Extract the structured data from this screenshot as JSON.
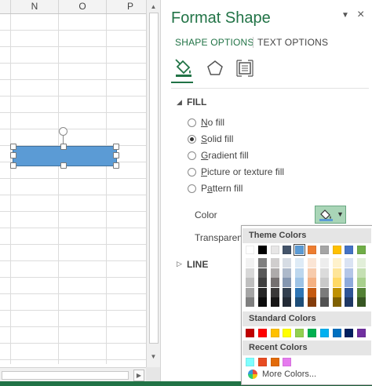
{
  "sheet": {
    "columns": [
      "N",
      "O",
      "P"
    ]
  },
  "pane": {
    "title": "Format Shape",
    "dropdown_icon": "triangle-down-icon",
    "close_label": "×",
    "tabs": [
      "SHAPE OPTIONS",
      "TEXT OPTIONS"
    ],
    "icons": [
      "fill-line-icon",
      "effects-pentagon-icon",
      "size-properties-icon"
    ],
    "fill_section": "FILL",
    "fill_options": [
      {
        "pre": "",
        "u": "N",
        "post": "o fill",
        "checked": false
      },
      {
        "pre": "",
        "u": "S",
        "post": "olid fill",
        "checked": true
      },
      {
        "pre": "",
        "u": "G",
        "post": "radient fill",
        "checked": false
      },
      {
        "pre": "",
        "u": "P",
        "post": "icture or texture fill",
        "checked": false
      },
      {
        "pre": "P",
        "u": "a",
        "post": "ttern fill",
        "checked": false
      }
    ],
    "color_label": "Color",
    "transparency_label": "Transparency",
    "line_section": "LINE"
  },
  "popup": {
    "theme_title": "Theme Colors",
    "theme_top": [
      "#ffffff",
      "#000000",
      "#e7e6e6",
      "#44546a",
      "#5b9bd5",
      "#ed7d31",
      "#a5a5a5",
      "#ffc000",
      "#4472c4",
      "#70ad47"
    ],
    "theme_shades": [
      [
        "#f2f2f2",
        "#7f7f7f",
        "#d0cece",
        "#d6dce4",
        "#deebf6",
        "#fbe5d5",
        "#ededed",
        "#fff2cc",
        "#dae3f3",
        "#e2efd9"
      ],
      [
        "#d8d8d8",
        "#595959",
        "#aeabab",
        "#adb9ca",
        "#bdd7ee",
        "#f7cbac",
        "#dbdbdb",
        "#fee599",
        "#b4c6e7",
        "#c5e0b3"
      ],
      [
        "#bfbfbf",
        "#3f3f3f",
        "#757070",
        "#8496b0",
        "#9dc3e6",
        "#f4b183",
        "#c9c9c9",
        "#ffd965",
        "#8eaadb",
        "#a8d08d"
      ],
      [
        "#a5a5a5",
        "#262626",
        "#3a3838",
        "#323f4f",
        "#2e75b5",
        "#c55a11",
        "#7b7b7b",
        "#bf9000",
        "#2f5496",
        "#538135"
      ],
      [
        "#7f7f7f",
        "#0c0c0c",
        "#171616",
        "#222a35",
        "#1e4e79",
        "#833c0b",
        "#525252",
        "#7f6000",
        "#1f3864",
        "#375623"
      ]
    ],
    "standard_title": "Standard Colors",
    "standard": [
      "#c00000",
      "#ff0000",
      "#ffc000",
      "#ffff00",
      "#92d050",
      "#00b050",
      "#00b0f0",
      "#0070c0",
      "#002060",
      "#7030a0"
    ],
    "recent_title": "Recent Colors",
    "recent": [
      "#7fffff",
      "#e84c22",
      "#e26b0a",
      "#e67bef"
    ],
    "more_label": "More Colors...",
    "more_icon": "color-wheel-icon"
  }
}
